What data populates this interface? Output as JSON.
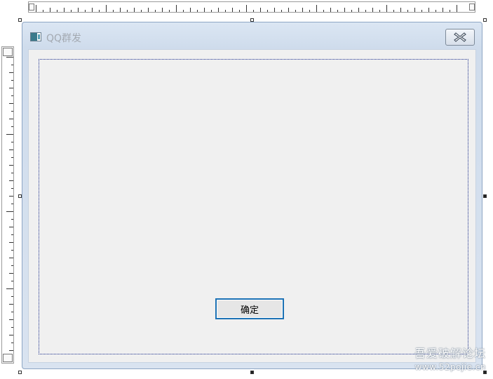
{
  "window": {
    "title": "QQ群发",
    "close_icon": "close-icon"
  },
  "form": {
    "ok_button_label": "确定"
  },
  "watermark": {
    "line1": "吾爱破解论坛",
    "line2": "www.52pojie.cn"
  }
}
